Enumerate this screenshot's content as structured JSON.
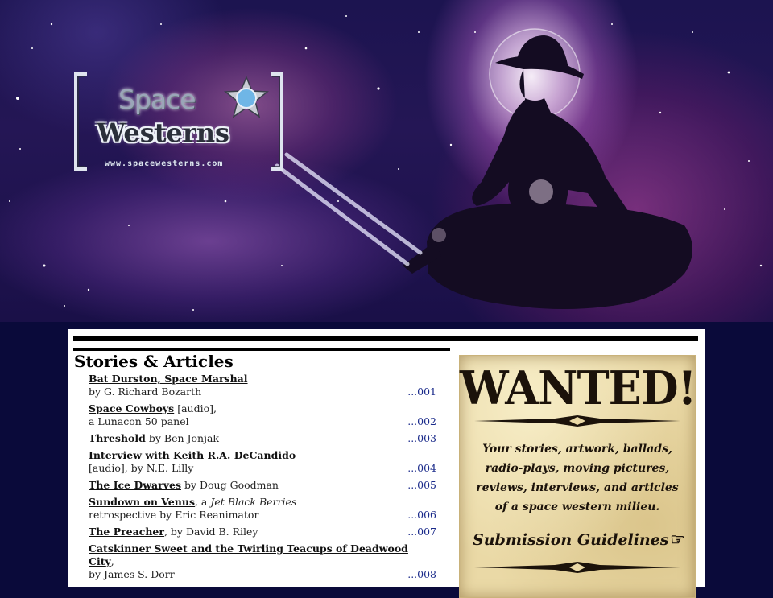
{
  "banner": {
    "logo_space": "Space",
    "logo_westerns": "Westerns",
    "logo_url": "www.spacewesterns.com"
  },
  "icons": {
    "logo_badge": "sheriff-star-icon",
    "guidelines_pointer": "pointing-hand-icon"
  },
  "colors": {
    "background": "#0a0a3a",
    "link_number": "#1a2a8a",
    "poster_paper": "#ead9a6"
  },
  "main": {
    "section_title": "Stories & Articles",
    "entries": [
      {
        "title": "Bat Durston, Space Marshal",
        "line2": "by G. Richard Bozarth",
        "num": "...001"
      },
      {
        "title": "Space Cowboys",
        "after": " [audio],",
        "line2": "a Lunacon 50 panel",
        "num": "...002"
      },
      {
        "title": "Threshold",
        "after": " by Ben Jonjak",
        "num": "...003"
      },
      {
        "title": "Interview with Keith R.A. DeCandido",
        "line2": "[audio], by N.E. Lilly",
        "num": "...004"
      },
      {
        "title": "The Ice Dwarves",
        "after": " by Doug Goodman",
        "num": "...005"
      },
      {
        "title": "Sundown on Venus",
        "after_pre": ", a ",
        "italic": "Jet Black Berries",
        "line2": "retrospective by Eric Reanimator",
        "num": "...006"
      },
      {
        "title": "The Preacher",
        "after": ", by David B. Riley",
        "num": "...007"
      },
      {
        "title": "Catskinner Sweet and the Twirling Teacups of Deadwood City",
        "after": ",",
        "line2": "by James S. Dorr",
        "num": "...008"
      }
    ]
  },
  "poster": {
    "heading": "WANTED!",
    "body": "Your stories, artwork, ballads, radio-plays, moving pictures, reviews, interviews, and articles of a space western milieu.",
    "link": "Submission Guidelines"
  }
}
